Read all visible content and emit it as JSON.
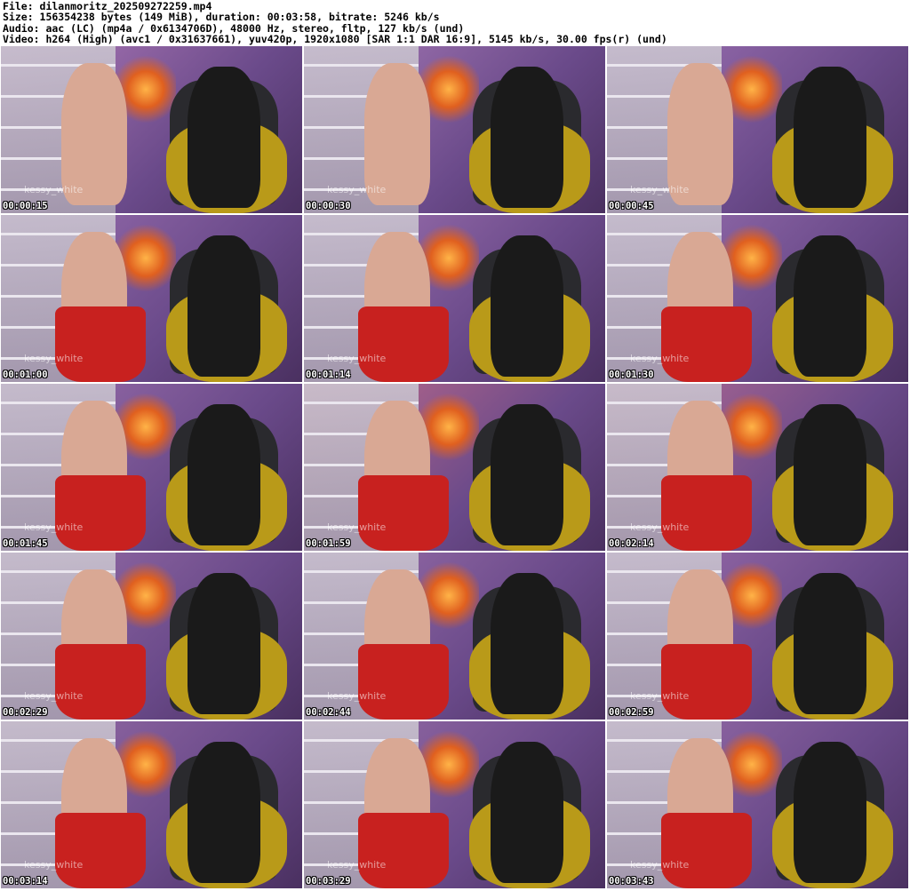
{
  "header": {
    "line1": "File: dilanmoritz_202509272259.mp4",
    "line2": "Size: 156354238 bytes (149 MiB), duration: 00:03:58, bitrate: 5246 kb/s",
    "line3": "Audio: aac (LC) (mp4a / 0x6134706D), 48000 Hz, stereo, fltp, 127 kb/s (und)",
    "line4": "Video: h264 (High) (avc1 / 0x31637661), yuv420p, 1920x1080 [SAR 1:1 DAR 16:9], 5145 kb/s, 30.00 fps(r) (und)"
  },
  "watermark": "kessy_white",
  "thumbnails": [
    {
      "time": "00:00:15",
      "hue": "#b07ab8",
      "skirt": false
    },
    {
      "time": "00:00:30",
      "hue": "#a87ab6",
      "skirt": false
    },
    {
      "time": "00:00:45",
      "hue": "#a073b4",
      "skirt": false
    },
    {
      "time": "00:01:00",
      "hue": "#9b6fb0",
      "skirt": true
    },
    {
      "time": "00:01:14",
      "hue": "#a274b2",
      "skirt": true
    },
    {
      "time": "00:01:30",
      "hue": "#9c72b2",
      "skirt": true
    },
    {
      "time": "00:01:45",
      "hue": "#9d70ad",
      "skirt": true
    },
    {
      "time": "00:01:59",
      "hue": "#c46c8a",
      "skirt": true
    },
    {
      "time": "00:02:14",
      "hue": "#b86c93",
      "skirt": true
    },
    {
      "time": "00:02:29",
      "hue": "#9a6fa9",
      "skirt": true
    },
    {
      "time": "00:02:44",
      "hue": "#9c70ab",
      "skirt": true
    },
    {
      "time": "00:02:59",
      "hue": "#a070ae",
      "skirt": true
    },
    {
      "time": "00:03:14",
      "hue": "#9a6ea8",
      "skirt": true
    },
    {
      "time": "00:03:29",
      "hue": "#9b6fa9",
      "skirt": true
    },
    {
      "time": "00:03:43",
      "hue": "#9c70ab",
      "skirt": true
    }
  ]
}
